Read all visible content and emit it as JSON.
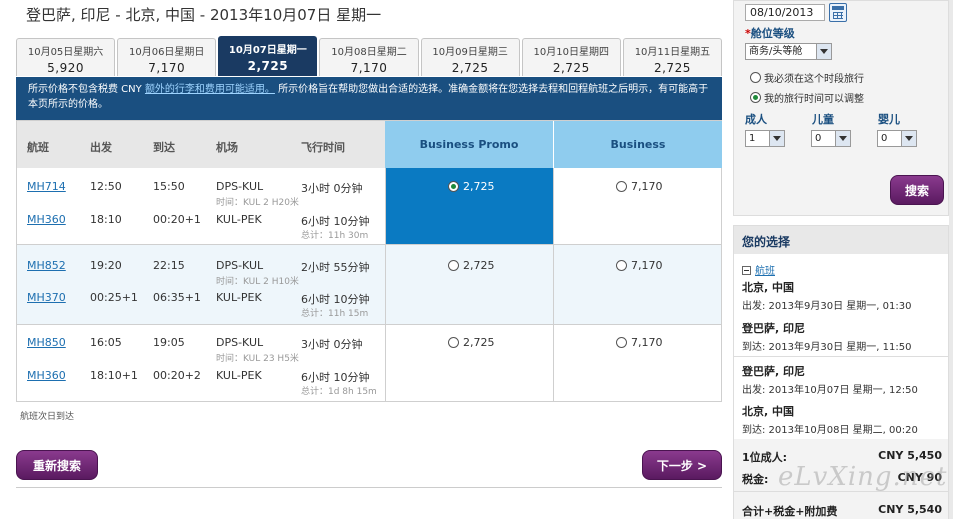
{
  "route_title": "登巴萨, 印尼 - 北京, 中国 - 2013年10月07日 星期一",
  "date_tabs": [
    {
      "date": "10月05日星期六",
      "price": "5,920"
    },
    {
      "date": "10月06日星期日",
      "price": "7,170"
    },
    {
      "date": "10月07日星期一",
      "price": "2,725"
    },
    {
      "date": "10月08日星期二",
      "price": "7,170"
    },
    {
      "date": "10月09日星期三",
      "price": "2,725"
    },
    {
      "date": "10月10日星期四",
      "price": "2,725"
    },
    {
      "date": "10月11日星期五",
      "price": "2,725"
    }
  ],
  "notice": {
    "pre": "所示价格不包含税费 CNY ",
    "link": "额外的行李和费用可能适用。",
    "post": " 所示价格旨在帮助您做出合适的选择。准确金额将在您选择去程和回程航班之后明示，有可能高于本页所示的价格。"
  },
  "columns": {
    "flight": "航班",
    "depart": "出发",
    "arrive": "到达",
    "airport": "机场",
    "duration": "飞行时间",
    "fare1": "Business Promo",
    "fare2": "Business"
  },
  "options": [
    {
      "legs": [
        {
          "flight": "MH714",
          "dep": "12:50",
          "arr": "15:50",
          "route": "DPS-KUL",
          "dur": "3小时 0分钟",
          "note": "时间：KUL 2 H20米"
        },
        {
          "flight": "MH360",
          "dep": "18:10",
          "arr": "00:20+1",
          "route": "KUL-PEK",
          "dur": "6小时 10分钟",
          "note": "总计：11h 30m"
        }
      ],
      "fare1": "2,725",
      "fare2": "7,170"
    },
    {
      "legs": [
        {
          "flight": "MH852",
          "dep": "19:20",
          "arr": "22:15",
          "route": "DPS-KUL",
          "dur": "2小时 55分钟",
          "note": "时间：KUL 2 H10米"
        },
        {
          "flight": "MH370",
          "dep": "00:25+1",
          "arr": "06:35+1",
          "route": "KUL-PEK",
          "dur": "6小时 10分钟",
          "note": "总计：11h 15m"
        }
      ],
      "fare1": "2,725",
      "fare2": "7,170"
    },
    {
      "legs": [
        {
          "flight": "MH850",
          "dep": "16:05",
          "arr": "19:05",
          "route": "DPS-KUL",
          "dur": "3小时 0分钟",
          "note": "时间：KUL 23 H5米"
        },
        {
          "flight": "MH360",
          "dep": "18:10+1",
          "arr": "00:20+2",
          "route": "KUL-PEK",
          "dur": "6小时 10分钟",
          "note": "总计：1d 8h 15m"
        }
      ],
      "fare1": "2,725",
      "fare2": "7,170"
    }
  ],
  "next_day_note": "航班次日到达",
  "buttons": {
    "research": "重新搜索",
    "next": "下一步 >",
    "search": "搜索"
  },
  "search_panel": {
    "date_value": "08/10/2013",
    "class_label": "舱位等级",
    "class_value": "商务/头等舱",
    "opt_fixed": "我必须在这个时段旅行",
    "opt_flexible": "我的旅行时间可以调整",
    "adult_label": "成人",
    "adult_value": "1",
    "child_label": "儿童",
    "child_value": "0",
    "infant_label": "婴儿",
    "infant_value": "0"
  },
  "choice": {
    "title": "您的选择",
    "flights_label": "航班",
    "seg1_city": "北京, 中国",
    "seg1_time": "出发: 2013年9月30日 星期一, 01:30",
    "seg2_city": "登巴萨, 印尼",
    "seg2_time": "到达: 2013年9月30日 星期一, 11:50",
    "seg3_city": "登巴萨, 印尼",
    "seg3_time": "出发: 2013年10月07日 星期一, 12:50",
    "seg4_city": "北京, 中国",
    "seg4_time": "到达: 2013年10月08日 星期二, 00:20",
    "adult_label": "1位成人:",
    "adult_price": "CNY 5,450",
    "tax_label": "税金:",
    "tax_price": "CNY 90",
    "total_label": "合计+税金+附加费",
    "total_price": "CNY 5,540"
  },
  "watermark": "eLvXing.net",
  "colors": {
    "selected_fare": "#0a7ac2",
    "header_fare": "#8fccee",
    "notice_bg": "#1a4f80",
    "button": "#6a2670"
  }
}
